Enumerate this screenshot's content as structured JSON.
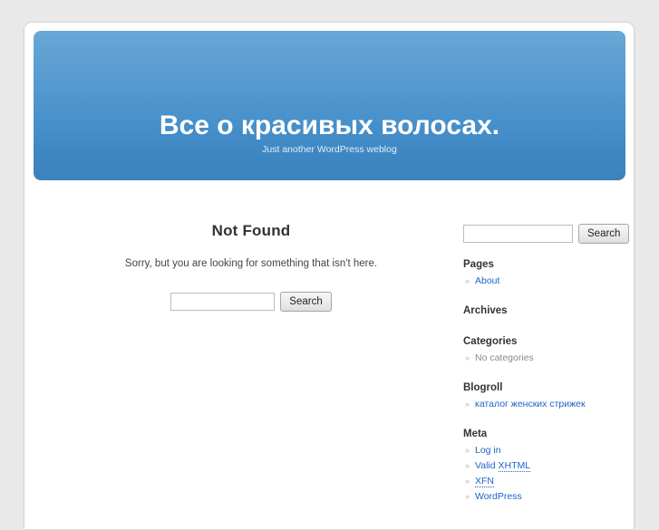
{
  "site": {
    "title": "Все о красивых волосах.",
    "description": "Just another WordPress weblog"
  },
  "main": {
    "heading": "Not Found",
    "message": "Sorry, but you are looking for something that isn't here.",
    "search": {
      "value": "",
      "placeholder": "",
      "submit_label": "Search"
    }
  },
  "sidebar": {
    "search": {
      "value": "",
      "placeholder": "",
      "submit_label": "Search"
    },
    "widgets": [
      {
        "title": "Pages",
        "items": [
          {
            "label": "About",
            "is_link": true
          }
        ]
      },
      {
        "title": "Archives",
        "items": []
      },
      {
        "title": "Categories",
        "items": [
          {
            "label": "No categories",
            "is_link": false
          }
        ]
      },
      {
        "title": "Blogroll",
        "items": [
          {
            "label": "каталог женских стрижек",
            "is_link": true
          }
        ]
      },
      {
        "title": "Meta",
        "items": [
          {
            "label": "Log in",
            "is_link": true
          },
          {
            "label": "Valid XHTML",
            "is_link": true,
            "abbr": "XHTML",
            "prefix": "Valid "
          },
          {
            "label": "XFN",
            "is_link": true,
            "abbr": "XFN",
            "prefix": ""
          },
          {
            "label": "WordPress",
            "is_link": true
          }
        ]
      }
    ]
  },
  "colors": {
    "page_background": "#e9e9e9",
    "container_background": "#ffffff",
    "header_gradient_top": "#69a8d7",
    "header_gradient_bottom": "#3c82bd",
    "link": "#1e63c8",
    "text": "#333333"
  }
}
